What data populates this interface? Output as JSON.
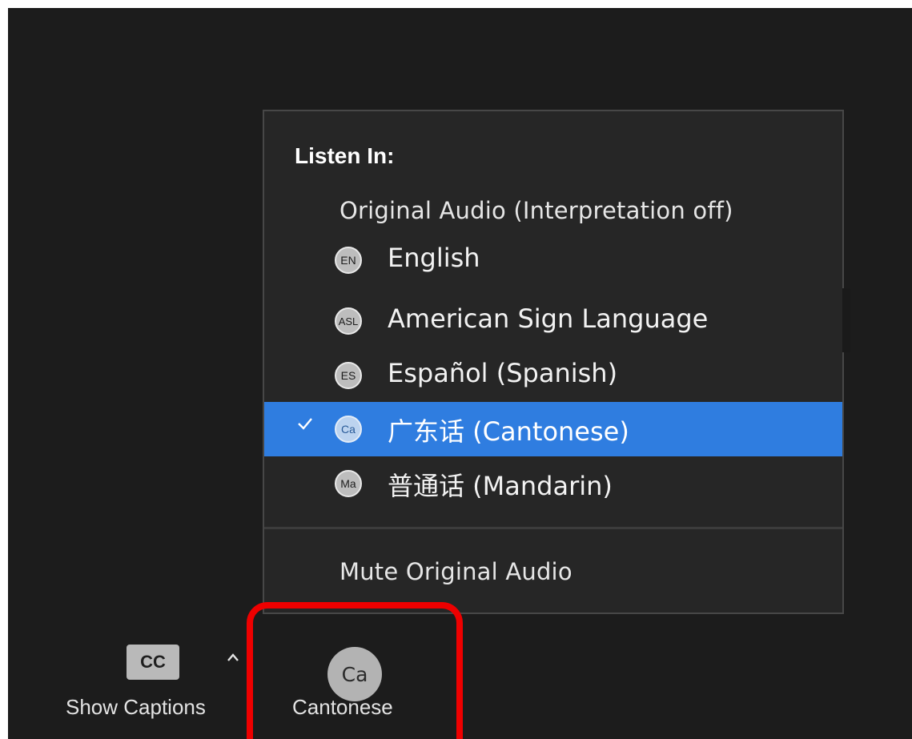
{
  "menu": {
    "heading": "Listen In:",
    "original_audio": "Original Audio (Interpretation off)",
    "languages": [
      {
        "badge": "EN",
        "label": "English",
        "selected": false
      },
      {
        "badge": "ASL",
        "label": "American Sign Language",
        "selected": false
      },
      {
        "badge": "ES",
        "label": "Español (Spanish)",
        "selected": false
      },
      {
        "badge": "Ca",
        "label": "广东话 (Cantonese)",
        "selected": true
      },
      {
        "badge": "Ma",
        "label": "普通话 (Mandarin)",
        "selected": false
      }
    ],
    "mute_original": "Mute Original Audio"
  },
  "toolbar": {
    "cc_label": "CC",
    "show_captions": "Show Captions",
    "interpretation_badge": "Ca",
    "interpretation_label": "Cantonese"
  },
  "colors": {
    "background": "#1c1c1c",
    "menu_background": "#262626",
    "selected_row": "#2f7de0",
    "highlight": "#ee0000"
  },
  "icons": {
    "check": "check-icon",
    "caret": "chevron-up-icon"
  }
}
